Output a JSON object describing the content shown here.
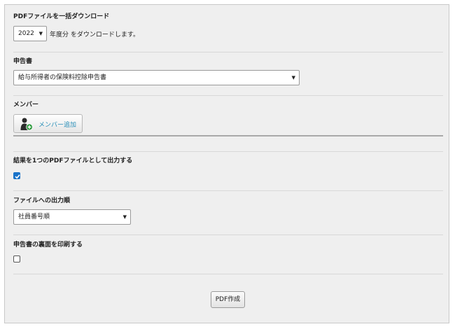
{
  "download_section": {
    "title": "PDFファイルを一括ダウンロード",
    "year_value": "2022",
    "year_suffix": "年度分 をダウンロードします。"
  },
  "declaration": {
    "title": "申告書",
    "selected": "給与所得者の保険料控除申告書"
  },
  "members": {
    "title": "メンバー",
    "add_button_label": "メンバー追加"
  },
  "single_pdf": {
    "title": "結果を1つのPDFファイルとして出力する",
    "checked": true
  },
  "output_order": {
    "title": "ファイルへの出力順",
    "selected": "社員番号順"
  },
  "print_back": {
    "title": "申告書の裏面を印刷する",
    "checked": false
  },
  "actions": {
    "create_pdf_label": "PDF作成"
  },
  "icons": {
    "dropdown": "chevron-down-icon",
    "member_add": "person-add-icon",
    "check": "check-icon"
  },
  "colors": {
    "link_blue": "#2a8fb8",
    "checkbox_blue": "#1a73c9",
    "panel_bg": "#efefef"
  }
}
